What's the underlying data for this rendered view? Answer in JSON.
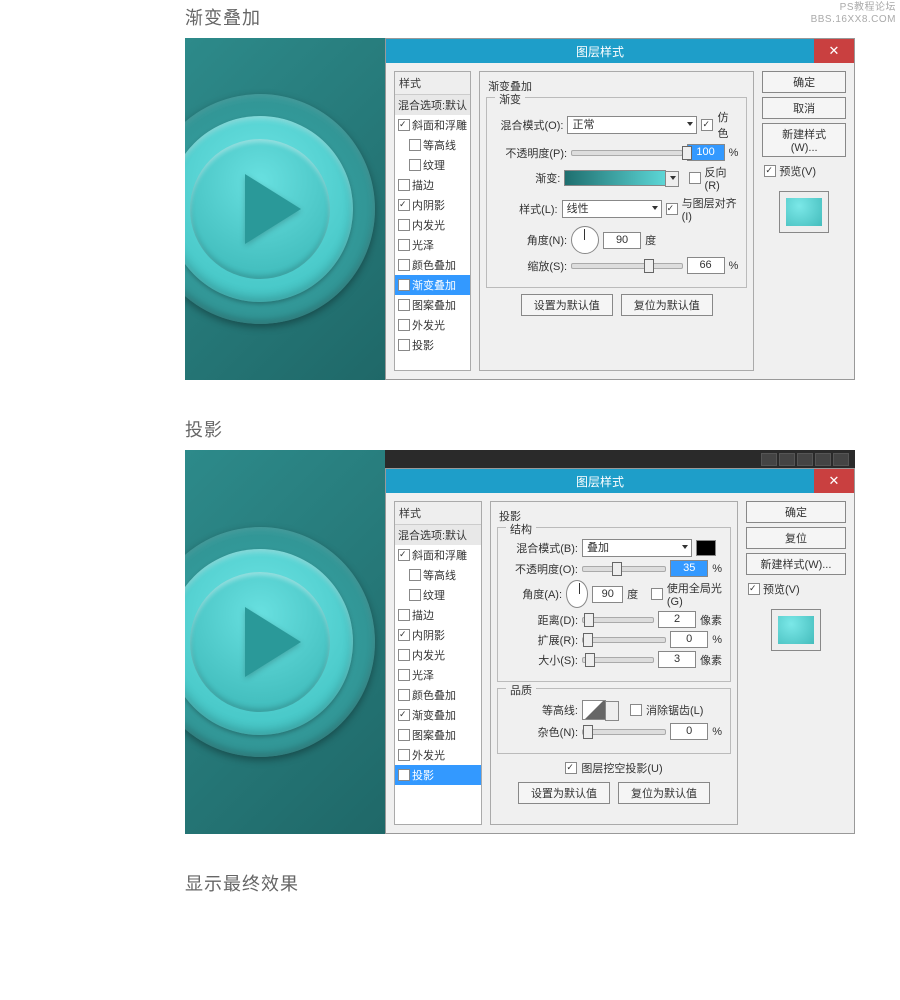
{
  "watermark": {
    "line1": "PS教程论坛",
    "line2": "BBS.16XX8.COM"
  },
  "section1": {
    "title": "渐变叠加",
    "dialog_title": "图层样式",
    "styles_header": "样式",
    "styles": [
      {
        "label": "混合选项:默认",
        "checked": false,
        "blending": true
      },
      {
        "label": "斜面和浮雕",
        "checked": true
      },
      {
        "label": "等高线",
        "checked": false,
        "indent": true
      },
      {
        "label": "纹理",
        "checked": false,
        "indent": true
      },
      {
        "label": "描边",
        "checked": false
      },
      {
        "label": "内阴影",
        "checked": true
      },
      {
        "label": "内发光",
        "checked": false
      },
      {
        "label": "光泽",
        "checked": false
      },
      {
        "label": "颜色叠加",
        "checked": false
      },
      {
        "label": "渐变叠加",
        "checked": true,
        "sel": true
      },
      {
        "label": "图案叠加",
        "checked": false
      },
      {
        "label": "外发光",
        "checked": false
      },
      {
        "label": "投影",
        "checked": false
      }
    ],
    "panel_title": "渐变叠加",
    "fs_gradient": "渐变",
    "blend_mode_label": "混合模式(O):",
    "blend_mode_value": "正常",
    "dither_label": "仿色",
    "dither_checked": true,
    "opacity_label": "不透明度(P):",
    "opacity_value": "100",
    "pct": "%",
    "gradient_label": "渐变:",
    "reverse_label": "反向(R)",
    "reverse_checked": false,
    "style_label": "样式(L):",
    "style_value": "线性",
    "align_label": "与图层对齐(I)",
    "align_checked": true,
    "angle_label": "角度(N):",
    "angle_value": "90",
    "deg": "度",
    "scale_label": "缩放(S):",
    "scale_value": "66",
    "btn_default": "设置为默认值",
    "btn_reset": "复位为默认值",
    "btn_ok": "确定",
    "btn_cancel": "取消",
    "btn_newstyle": "新建样式(W)...",
    "preview_label": "预览(V)",
    "preview_checked": true
  },
  "section2": {
    "title": "投影",
    "dialog_title": "图层样式",
    "styles_header": "样式",
    "styles": [
      {
        "label": "混合选项:默认",
        "checked": false,
        "blending": true
      },
      {
        "label": "斜面和浮雕",
        "checked": true
      },
      {
        "label": "等高线",
        "checked": false,
        "indent": true
      },
      {
        "label": "纹理",
        "checked": false,
        "indent": true
      },
      {
        "label": "描边",
        "checked": false
      },
      {
        "label": "内阴影",
        "checked": true
      },
      {
        "label": "内发光",
        "checked": false
      },
      {
        "label": "光泽",
        "checked": false
      },
      {
        "label": "颜色叠加",
        "checked": false
      },
      {
        "label": "渐变叠加",
        "checked": true
      },
      {
        "label": "图案叠加",
        "checked": false
      },
      {
        "label": "外发光",
        "checked": false
      },
      {
        "label": "投影",
        "checked": true,
        "sel": true
      }
    ],
    "panel_title": "投影",
    "fs_structure": "结构",
    "blend_mode_label": "混合模式(B):",
    "blend_mode_value": "叠加",
    "opacity_label": "不透明度(O):",
    "opacity_value": "35",
    "pct": "%",
    "angle_label": "角度(A):",
    "angle_value": "90",
    "deg": "度",
    "global_label": "使用全局光(G)",
    "global_checked": false,
    "distance_label": "距离(D):",
    "distance_value": "2",
    "px": "像素",
    "spread_label": "扩展(R):",
    "spread_value": "0",
    "size_label": "大小(S):",
    "size_value": "3",
    "fs_quality": "品质",
    "contour_label": "等高线:",
    "antialias_label": "消除锯齿(L)",
    "antialias_checked": false,
    "noise_label": "杂色(N):",
    "noise_value": "0",
    "knockout_label": "图层挖空投影(U)",
    "knockout_checked": true,
    "btn_default": "设置为默认值",
    "btn_reset": "复位为默认值",
    "btn_ok": "确定",
    "btn_cancel": "复位",
    "btn_newstyle": "新建样式(W)...",
    "preview_label": "预览(V)",
    "preview_checked": true
  },
  "section3": {
    "title": "显示最终效果"
  }
}
